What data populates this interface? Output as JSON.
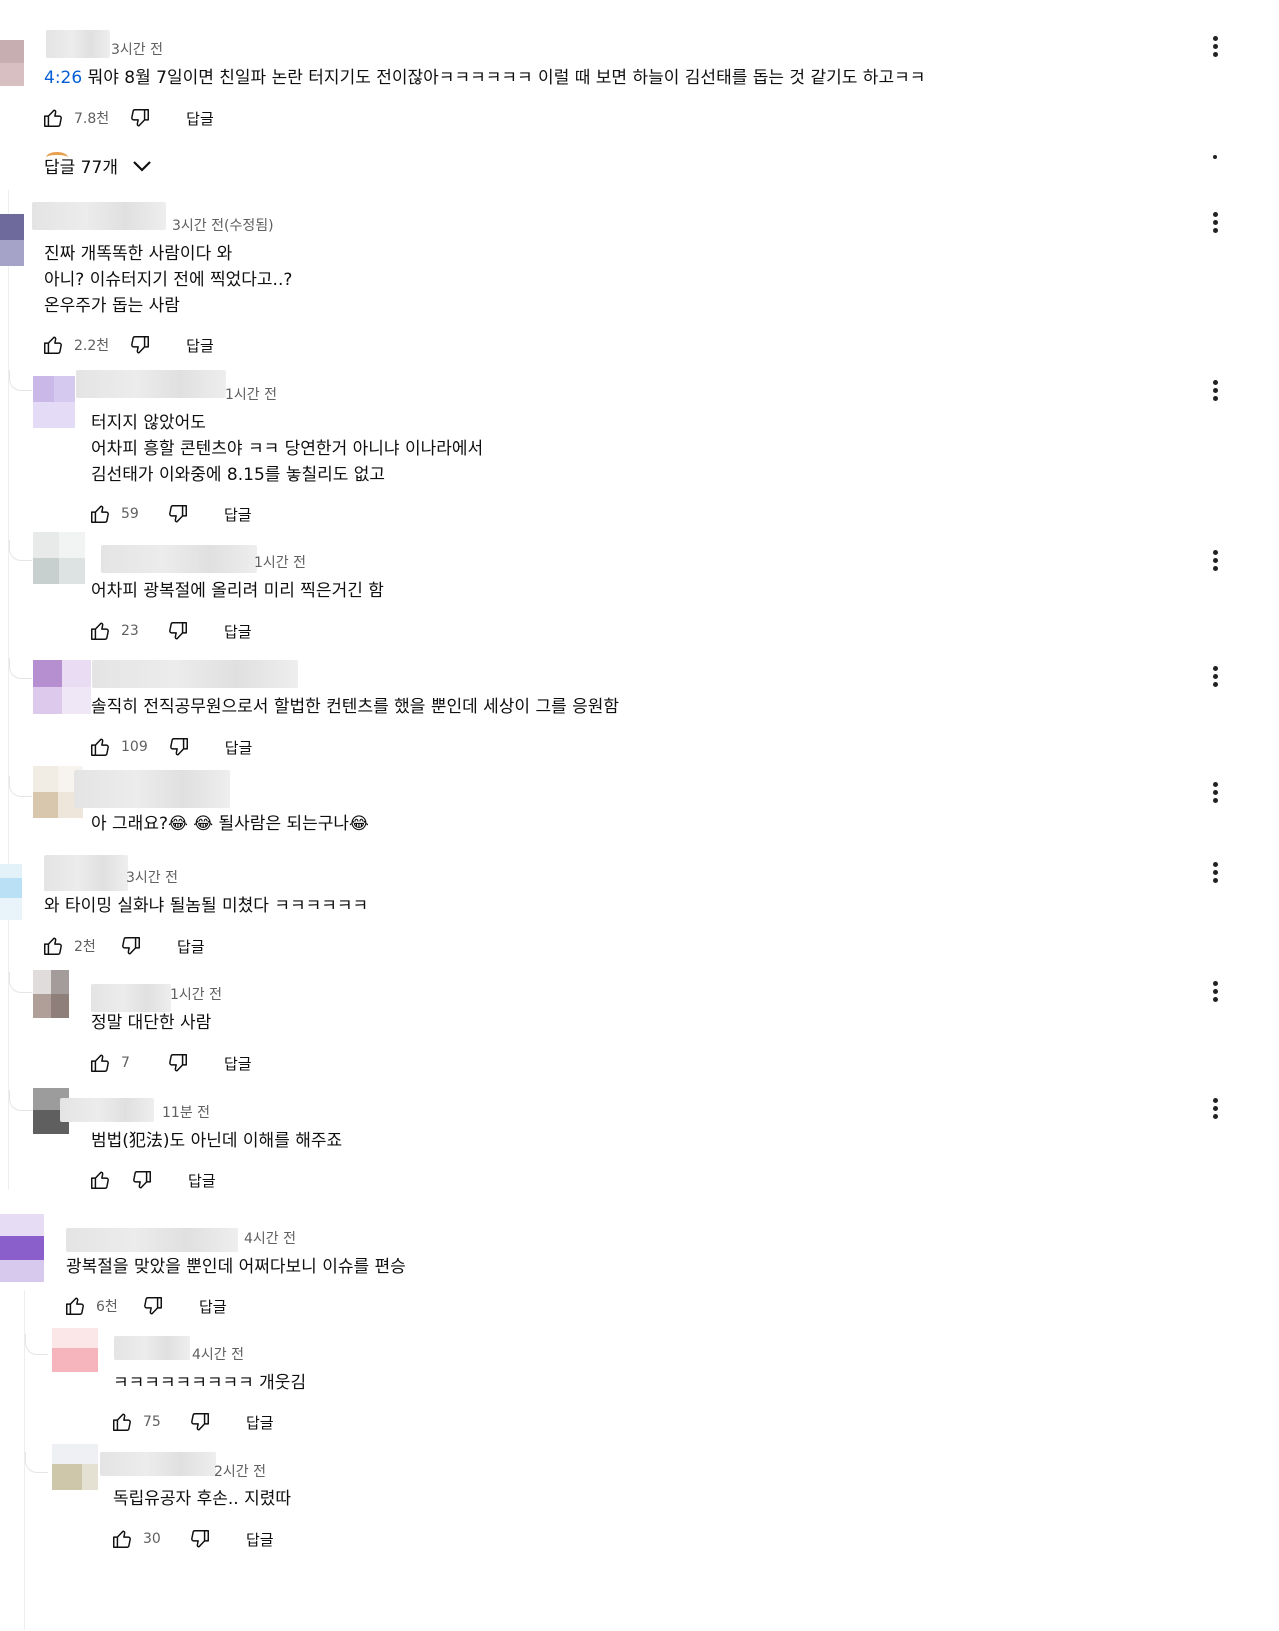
{
  "comments": [
    {
      "time": "3시간 전",
      "text": "뭐야 8월 7일이면 친일파 논란 터지기도 전이잖아ㅋㅋㅋㅋㅋㅋ 이럴 때 보면 하늘이 김선태를 돕는 것 같기도 하고ㅋㅋ",
      "timestamp_link": "4:26",
      "likes": "7.8천",
      "reply_label": "답글"
    },
    {
      "time": "3시간 전(수정됨)",
      "text": "진짜 개똑똑한 사람이다 와\n아니? 이슈터지기 전에 찍었다고..?\n온우주가 돕는 사람",
      "likes": "2.2천",
      "reply_label": "답글"
    },
    {
      "time": "1시간 전",
      "text": "터지지 않았어도\n어차피 흥할 콘텐츠야 ㅋㅋ 당연한거 아니냐 이나라에서\n김선태가 이와중에 8.15를 놓칠리도 없고",
      "likes": "59",
      "reply_label": "답글"
    },
    {
      "time": "1시간 전",
      "text": "어차피 광복절에 올리려 미리 찍은거긴 함",
      "likes": "23",
      "reply_label": "답글"
    },
    {
      "time": "",
      "text": "솔직히 전직공무원으로서 할법한 컨텐츠를 했을 뿐인데 세상이 그를 응원함",
      "likes": "109",
      "reply_label": "답글"
    },
    {
      "time": "",
      "text": "아 그래요?😂 😂 될사람은 되는구나😂",
      "likes": "",
      "reply_label": ""
    },
    {
      "time": "3시간 전",
      "text": "와 타이밍 실화냐 될놈될 미쳤다 ㅋㅋㅋㅋㅋㅋ",
      "likes": "2천",
      "reply_label": "답글"
    },
    {
      "time": "1시간 전",
      "text": "정말 대단한 사람",
      "likes": "7",
      "reply_label": "답글"
    },
    {
      "time": "11분 전",
      "text": "범법(犯法)도 아닌데 이해를 해주죠",
      "likes": "",
      "reply_label": "답글"
    },
    {
      "time": "4시간 전",
      "text": "광복절을 맞았을 뿐인데 어쩌다보니 이슈를 편승",
      "likes": "6천",
      "reply_label": "답글"
    },
    {
      "time": "4시간 전",
      "text": "ㅋㅋㅋㅋㅋㅋㅋㅋㅋ 개웃김",
      "likes": "75",
      "reply_label": "답글"
    },
    {
      "time": "2시간 전",
      "text": "독립유공자 후손.. 지렸따",
      "likes": "30",
      "reply_label": "답글"
    }
  ],
  "replies_toggle": {
    "label": "답글 77개"
  },
  "icons": {
    "like": "thumbs-up-icon",
    "dislike": "thumbs-down-icon",
    "more": "more-vert-icon",
    "chevron": "chevron-down-icon"
  }
}
